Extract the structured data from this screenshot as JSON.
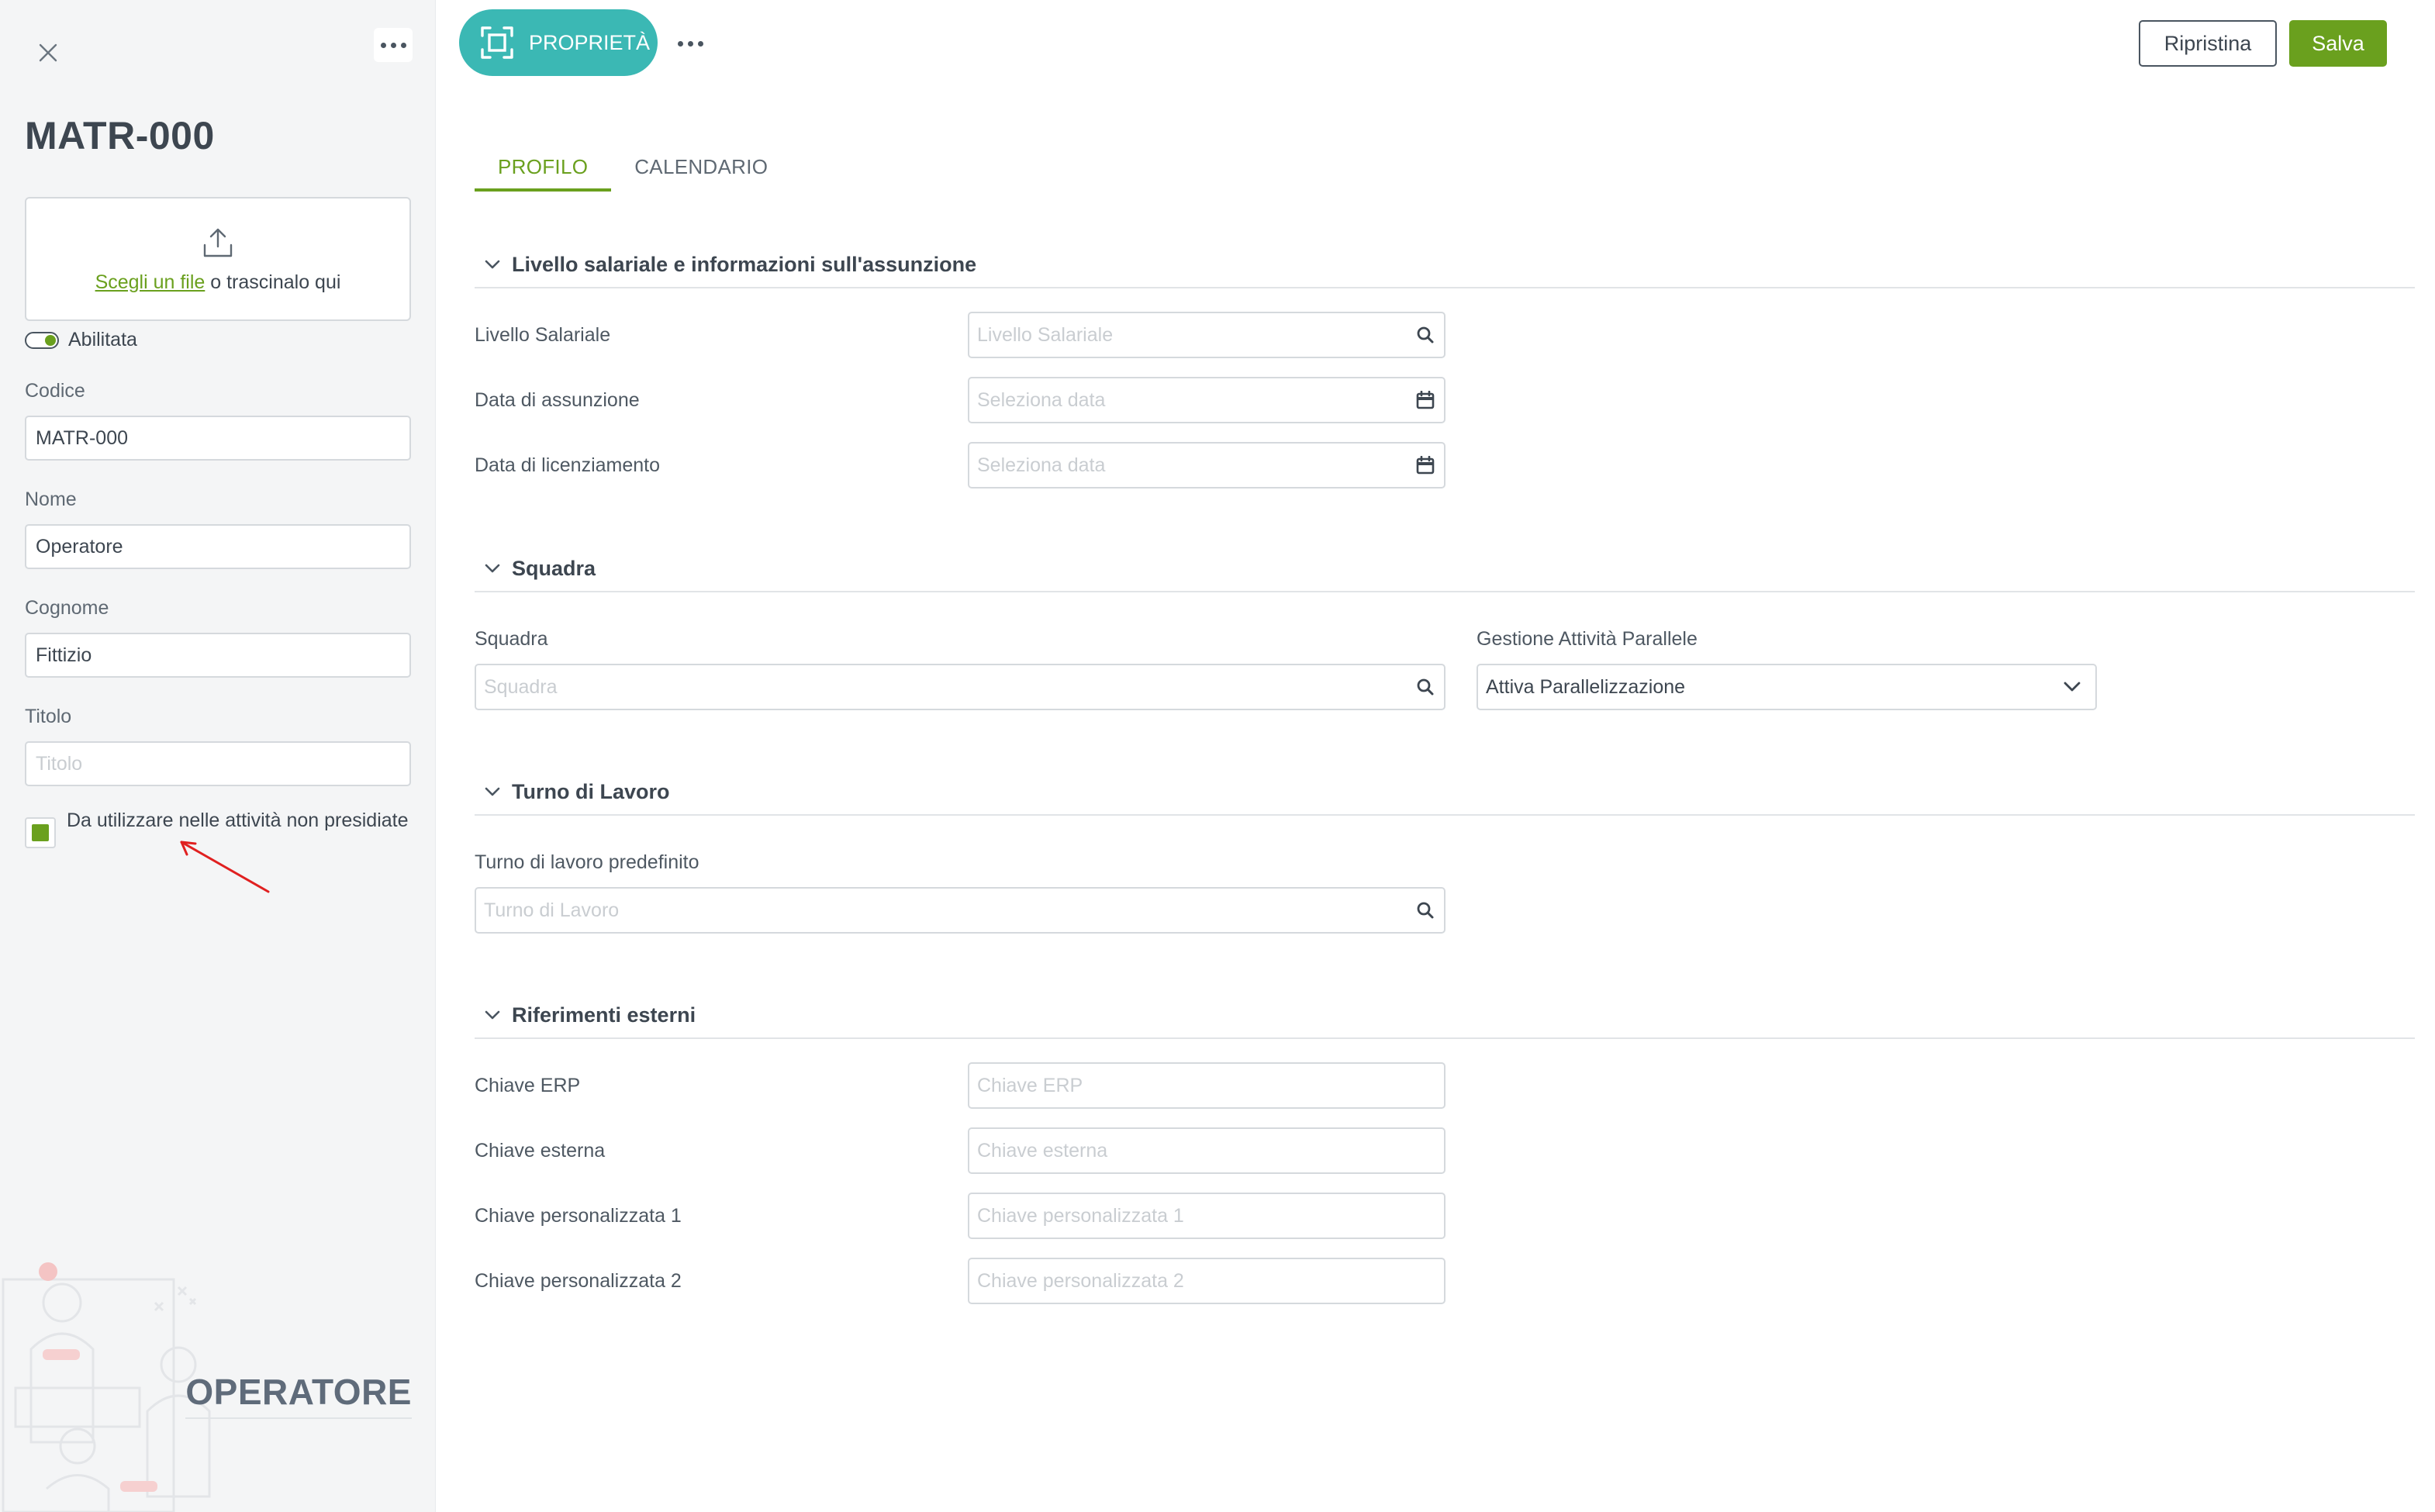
{
  "sidebar": {
    "title": "MATR-000",
    "upload": {
      "link_text": "Scegli un file",
      "rest_text": " o trascinalo qui"
    },
    "enabled_label": "Abilitata",
    "fields": [
      {
        "label": "Codice",
        "value": "MATR-000",
        "placeholder": ""
      },
      {
        "label": "Nome",
        "value": "Operatore",
        "placeholder": ""
      },
      {
        "label": "Cognome",
        "value": "Fittizio",
        "placeholder": ""
      },
      {
        "label": "Titolo",
        "value": "",
        "placeholder": "Titolo"
      }
    ],
    "checkbox": {
      "label": "Da utilizzare nelle attività non presidiate",
      "checked": true
    },
    "entity_label": "OPERATORE"
  },
  "toolbar": {
    "properties_label": "PROPRIETÀ",
    "reset_label": "Ripristina",
    "save_label": "Salva"
  },
  "tabs": [
    {
      "label": "PROFILO",
      "active": true
    },
    {
      "label": "CALENDARIO",
      "active": false
    }
  ],
  "sections": {
    "salary": {
      "title": "Livello salariale e informazioni sull'assunzione",
      "fields": [
        {
          "label": "Livello Salariale",
          "placeholder": "Livello Salariale",
          "icon": "search-icon"
        },
        {
          "label": "Data di assunzione",
          "placeholder": "Seleziona data",
          "icon": "calendar-icon"
        },
        {
          "label": "Data di licenziamento",
          "placeholder": "Seleziona data",
          "icon": "calendar-icon"
        }
      ]
    },
    "team": {
      "title": "Squadra",
      "team_label": "Squadra",
      "team_placeholder": "Squadra",
      "parallel_label": "Gestione Attività Parallele",
      "parallel_value": "Attiva Parallelizzazione"
    },
    "shift": {
      "title": "Turno di Lavoro",
      "label": "Turno di lavoro predefinito",
      "placeholder": "Turno di Lavoro"
    },
    "external": {
      "title": "Riferimenti esterni",
      "fields": [
        {
          "label": "Chiave ERP",
          "placeholder": "Chiave ERP"
        },
        {
          "label": "Chiave esterna",
          "placeholder": "Chiave esterna"
        },
        {
          "label": "Chiave personalizzata 1",
          "placeholder": "Chiave personalizzata 1"
        },
        {
          "label": "Chiave personalizzata 2",
          "placeholder": "Chiave personalizzata 2"
        }
      ]
    }
  },
  "colors": {
    "accent_green": "#6aa01e",
    "teal": "#3bb8b4",
    "annotation_red": "#e02020"
  }
}
